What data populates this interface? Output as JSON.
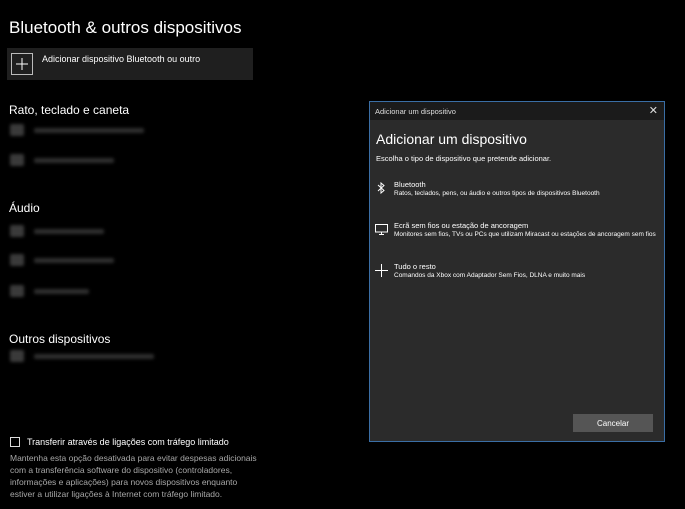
{
  "page": {
    "title": "Bluetooth & outros dispositivos"
  },
  "add_device": {
    "label": "Adicionar dispositivo Bluetooth ou outro",
    "icon": "plus-icon"
  },
  "sections": {
    "input": {
      "title": "Rato, teclado e caneta"
    },
    "audio": {
      "title": "Áudio"
    },
    "other": {
      "title": "Outros dispositivos"
    }
  },
  "metered": {
    "checkbox_label": "Transferir através de ligações com tráfego limitado",
    "checked": false,
    "description": "Mantenha esta opção desativada para evitar despesas adicionais com a transferência software do dispositivo (controladores, informações e aplicações) para novos dispositivos enquanto estiver a utilizar ligações à Internet com tráfego limitado."
  },
  "dialog": {
    "window_title": "Adicionar um dispositivo",
    "heading": "Adicionar um dispositivo",
    "subtitle": "Escolha o tipo de dispositivo que pretende adicionar.",
    "options": [
      {
        "icon": "bluetooth-icon",
        "title": "Bluetooth",
        "desc": "Ratos, teclados, pens, ou áudio e outros tipos de dispositivos Bluetooth"
      },
      {
        "icon": "monitor-icon",
        "title": "Ecrã sem fios ou estação de ancoragem",
        "desc": "Monitores sem fios, TVs ou PCs que utilizam Miracast ou estações de ancoragem sem fios"
      },
      {
        "icon": "plus-icon",
        "title": "Tudo o resto",
        "desc": "Comandos da Xbox com Adaptador Sem Fios, DLNA e muito mais"
      }
    ],
    "cancel_label": "Cancelar",
    "accent_border": "#3a6ea5"
  }
}
